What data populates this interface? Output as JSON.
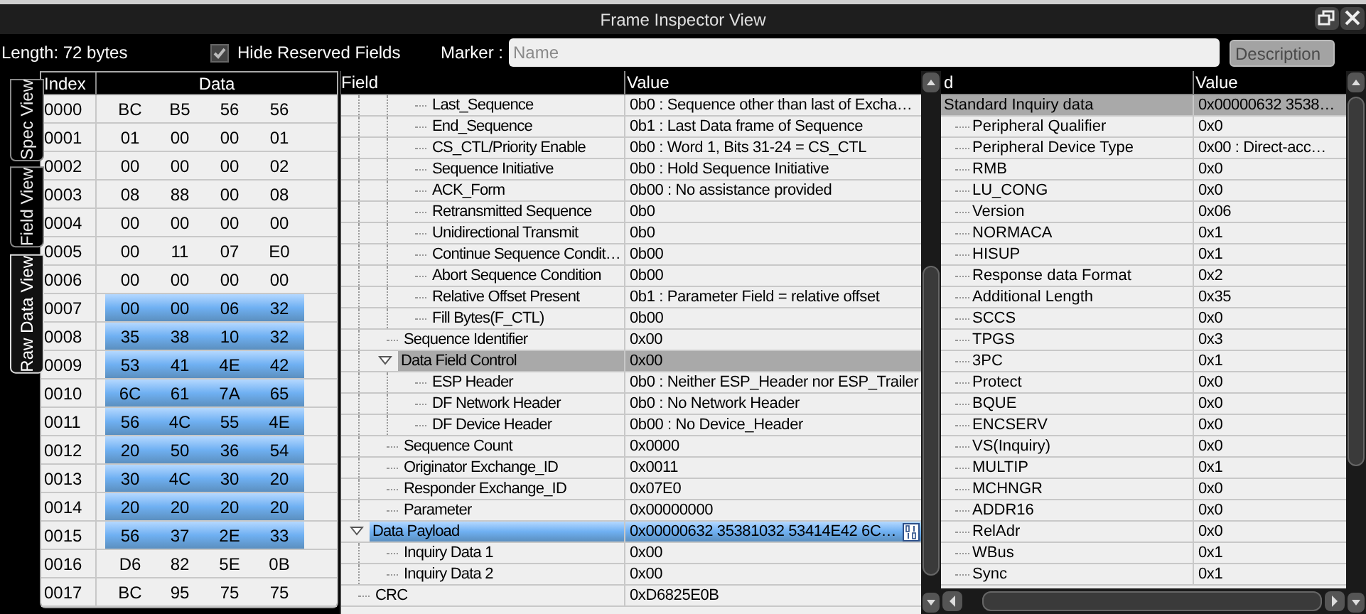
{
  "window": {
    "title": "Frame Inspector View"
  },
  "toolbar": {
    "length": "Length: 72 bytes",
    "hide_reserved": {
      "label": "Hide Reserved Fields",
      "checked": true
    },
    "marker_label": "Marker :",
    "marker": {
      "placeholder": "Name"
    },
    "description": {
      "label": "Description",
      "disabled": true
    }
  },
  "view_tabs": [
    {
      "label": "Spec View",
      "selected": false
    },
    {
      "label": "Field View",
      "selected": false
    },
    {
      "label": "Raw Data View",
      "selected": true
    }
  ],
  "hex_table": {
    "columns": [
      "Index",
      "Data"
    ],
    "rows": [
      {
        "index": "0000",
        "bytes": [
          "BC",
          "B5",
          "56",
          "56"
        ],
        "selected": false
      },
      {
        "index": "0001",
        "bytes": [
          "01",
          "00",
          "00",
          "01"
        ],
        "selected": false
      },
      {
        "index": "0002",
        "bytes": [
          "00",
          "00",
          "00",
          "02"
        ],
        "selected": false
      },
      {
        "index": "0003",
        "bytes": [
          "08",
          "88",
          "00",
          "08"
        ],
        "selected": false
      },
      {
        "index": "0004",
        "bytes": [
          "00",
          "00",
          "00",
          "00"
        ],
        "selected": false
      },
      {
        "index": "0005",
        "bytes": [
          "00",
          "11",
          "07",
          "E0"
        ],
        "selected": false
      },
      {
        "index": "0006",
        "bytes": [
          "00",
          "00",
          "00",
          "00"
        ],
        "selected": false
      },
      {
        "index": "0007",
        "bytes": [
          "00",
          "00",
          "06",
          "32"
        ],
        "selected": true
      },
      {
        "index": "0008",
        "bytes": [
          "35",
          "38",
          "10",
          "32"
        ],
        "selected": true
      },
      {
        "index": "0009",
        "bytes": [
          "53",
          "41",
          "4E",
          "42"
        ],
        "selected": true
      },
      {
        "index": "0010",
        "bytes": [
          "6C",
          "61",
          "7A",
          "65"
        ],
        "selected": true
      },
      {
        "index": "0011",
        "bytes": [
          "56",
          "4C",
          "55",
          "4E"
        ],
        "selected": true
      },
      {
        "index": "0012",
        "bytes": [
          "20",
          "50",
          "36",
          "54"
        ],
        "selected": true
      },
      {
        "index": "0013",
        "bytes": [
          "30",
          "4C",
          "30",
          "20"
        ],
        "selected": true
      },
      {
        "index": "0014",
        "bytes": [
          "20",
          "20",
          "20",
          "20"
        ],
        "selected": true
      },
      {
        "index": "0015",
        "bytes": [
          "56",
          "37",
          "2E",
          "33"
        ],
        "selected": true
      },
      {
        "index": "0016",
        "bytes": [
          "D6",
          "82",
          "5E",
          "0B"
        ],
        "selected": false
      },
      {
        "index": "0017",
        "bytes": [
          "BC",
          "95",
          "75",
          "75"
        ],
        "selected": false
      }
    ]
  },
  "field_tree": {
    "columns": [
      "Field",
      "Value"
    ],
    "rows": [
      {
        "kind": "continuation",
        "children": [
          {
            "kind": "continuation",
            "children": [
              {
                "kind": "field",
                "field": "Last_Sequence",
                "value": "0b0 : Sequence other than last of Excha…",
                "selected": false,
                "highlighted": false
              },
              {
                "kind": "field",
                "field": "End_Sequence",
                "value": "0b1 : Last Data frame of Sequence",
                "selected": false,
                "highlighted": false
              },
              {
                "kind": "field",
                "field": "CS_CTL/Priority Enable",
                "value": "0b0 : Word 1, Bits 31-24 = CS_CTL",
                "selected": false,
                "highlighted": false
              },
              {
                "kind": "field",
                "field": "Sequence Initiative",
                "value": "0b0 : Hold Sequence Initiative",
                "selected": false,
                "highlighted": false
              },
              {
                "kind": "field",
                "field": "ACK_Form",
                "value": "0b00 : No assistance provided",
                "selected": false,
                "highlighted": false
              },
              {
                "kind": "field",
                "field": "Retransmitted Sequence",
                "value": "0b0",
                "selected": false,
                "highlighted": false
              },
              {
                "kind": "field",
                "field": "Unidirectional Transmit",
                "value": "0b0",
                "selected": false,
                "highlighted": false
              },
              {
                "kind": "field",
                "field": "Continue Sequence Condit…",
                "value": "0b00",
                "selected": false,
                "highlighted": false
              },
              {
                "kind": "field",
                "field": "Abort Sequence Condition",
                "value": "0b00",
                "selected": false,
                "highlighted": false
              },
              {
                "kind": "field",
                "field": "Relative Offset Present",
                "value": "0b1 : Parameter Field = relative offset",
                "selected": false,
                "highlighted": false
              },
              {
                "kind": "field",
                "field": "Fill Bytes(F_CTL)",
                "value": "0b00",
                "selected": false,
                "highlighted": false
              }
            ]
          },
          {
            "kind": "field",
            "field": "Sequence Identifier",
            "value": "0x00",
            "selected": false,
            "highlighted": false
          },
          {
            "kind": "field",
            "field": "Data Field Control",
            "value": "0x00",
            "selected": false,
            "highlighted": true,
            "expanded": true,
            "children": [
              {
                "kind": "field",
                "field": "ESP Header",
                "value": "0b0 : Neither ESP_Header nor ESP_Trailer",
                "selected": false,
                "highlighted": false
              },
              {
                "kind": "field",
                "field": "DF Network Header",
                "value": "0b0 : No Network Header",
                "selected": false,
                "highlighted": false
              },
              {
                "kind": "field",
                "field": "DF Device Header",
                "value": "0b00 : No Device_Header",
                "selected": false,
                "highlighted": false
              }
            ]
          },
          {
            "kind": "field",
            "field": "Sequence Count",
            "value": "0x0000",
            "selected": false,
            "highlighted": false
          },
          {
            "kind": "field",
            "field": "Originator Exchange_ID",
            "value": "0x0011",
            "selected": false,
            "highlighted": false
          },
          {
            "kind": "field",
            "field": "Responder Exchange_ID",
            "value": "0x07E0",
            "selected": false,
            "highlighted": false
          },
          {
            "kind": "field",
            "field": "Parameter",
            "value": "0x00000000",
            "selected": false,
            "highlighted": false
          }
        ]
      },
      {
        "kind": "field",
        "field": "Data Payload",
        "value": "0x00000632 35381032 53414E42 6C…",
        "selected": true,
        "expanded": true,
        "binary_button": true,
        "children": [
          {
            "kind": "field",
            "field": "Inquiry Data 1",
            "value": "0x00",
            "selected": false,
            "highlighted": false
          },
          {
            "kind": "field",
            "field": "Inquiry Data 2",
            "value": "0x00",
            "selected": false,
            "highlighted": false
          }
        ]
      },
      {
        "kind": "field",
        "field": "CRC",
        "value": "0xD6825E0B",
        "selected": false,
        "highlighted": false
      }
    ]
  },
  "inquiry_tree": {
    "columns": [
      "d",
      "Value"
    ],
    "rows": [
      {
        "field": "Standard Inquiry data",
        "value": "0x00000632 3538…",
        "highlighted": true,
        "children": [
          {
            "field": "Peripheral Qualifier",
            "value": "0x0",
            "highlighted": false
          },
          {
            "field": "Peripheral Device Type",
            "value": "0x00 : Direct-acc…",
            "highlighted": false
          },
          {
            "field": "RMB",
            "value": "0x0",
            "highlighted": false
          },
          {
            "field": "LU_CONG",
            "value": "0x0",
            "highlighted": false
          },
          {
            "field": "Version",
            "value": "0x06",
            "highlighted": false
          },
          {
            "field": "NORMACA",
            "value": "0x1",
            "highlighted": false
          },
          {
            "field": "HISUP",
            "value": "0x1",
            "highlighted": false
          },
          {
            "field": "Response data Format",
            "value": "0x2",
            "highlighted": false
          },
          {
            "field": "Additional Length",
            "value": "0x35",
            "highlighted": false
          },
          {
            "field": "SCCS",
            "value": "0x0",
            "highlighted": false
          },
          {
            "field": "TPGS",
            "value": "0x3",
            "highlighted": false
          },
          {
            "field": "3PC",
            "value": "0x1",
            "highlighted": false
          },
          {
            "field": "Protect",
            "value": "0x0",
            "highlighted": false
          },
          {
            "field": "BQUE",
            "value": "0x0",
            "highlighted": false
          },
          {
            "field": "ENCSERV",
            "value": "0x0",
            "highlighted": false
          },
          {
            "field": "VS(Inquiry)",
            "value": "0x0",
            "highlighted": false
          },
          {
            "field": "MULTIP",
            "value": "0x1",
            "highlighted": false
          },
          {
            "field": "MCHNGR",
            "value": "0x0",
            "highlighted": false
          },
          {
            "field": "ADDR16",
            "value": "0x0",
            "highlighted": false
          },
          {
            "field": "RelAdr",
            "value": "0x0",
            "highlighted": false
          },
          {
            "field": "WBus",
            "value": "0x1",
            "highlighted": false
          },
          {
            "field": "Sync",
            "value": "0x1",
            "highlighted": false
          }
        ]
      }
    ]
  }
}
